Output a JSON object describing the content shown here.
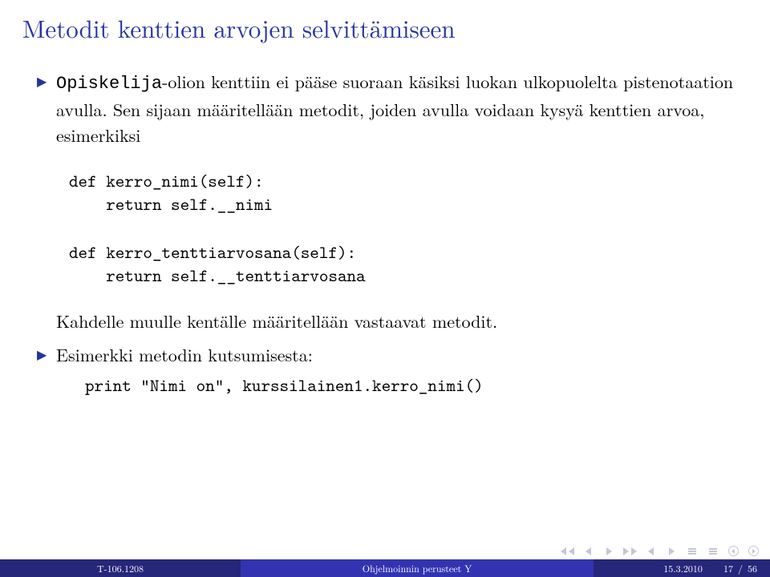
{
  "title": "Metodit kenttien arvojen selvittämiseen",
  "bullets": {
    "b1_pre": "Opiskelija",
    "b1_post": "-olion kenttiin ei pääse suoraan käsiksi luokan ulkopuolelta pistenotaation avulla. Sen sijaan määritellään metodit, joiden avulla voidaan kysyä kenttien arvoa, esimerkiksi",
    "note": "Kahdelle muulle kentälle määritellään vastaavat metodit.",
    "b2": "Esimerkki metodin kutsumisesta:"
  },
  "code": {
    "block": "def kerro_nimi(self):\n    return self.__nimi\n\ndef kerro_tenttiarvosana(self):\n    return self.__tenttiarvosana",
    "inline": "print \"Nimi on\", kurssilainen1.kerro_nimi()"
  },
  "footer": {
    "left": "T-106.1208",
    "mid": "Ohjelmoinnin perusteet Y",
    "date": "15.3.2010",
    "page_current": "17",
    "page_total": "56"
  }
}
